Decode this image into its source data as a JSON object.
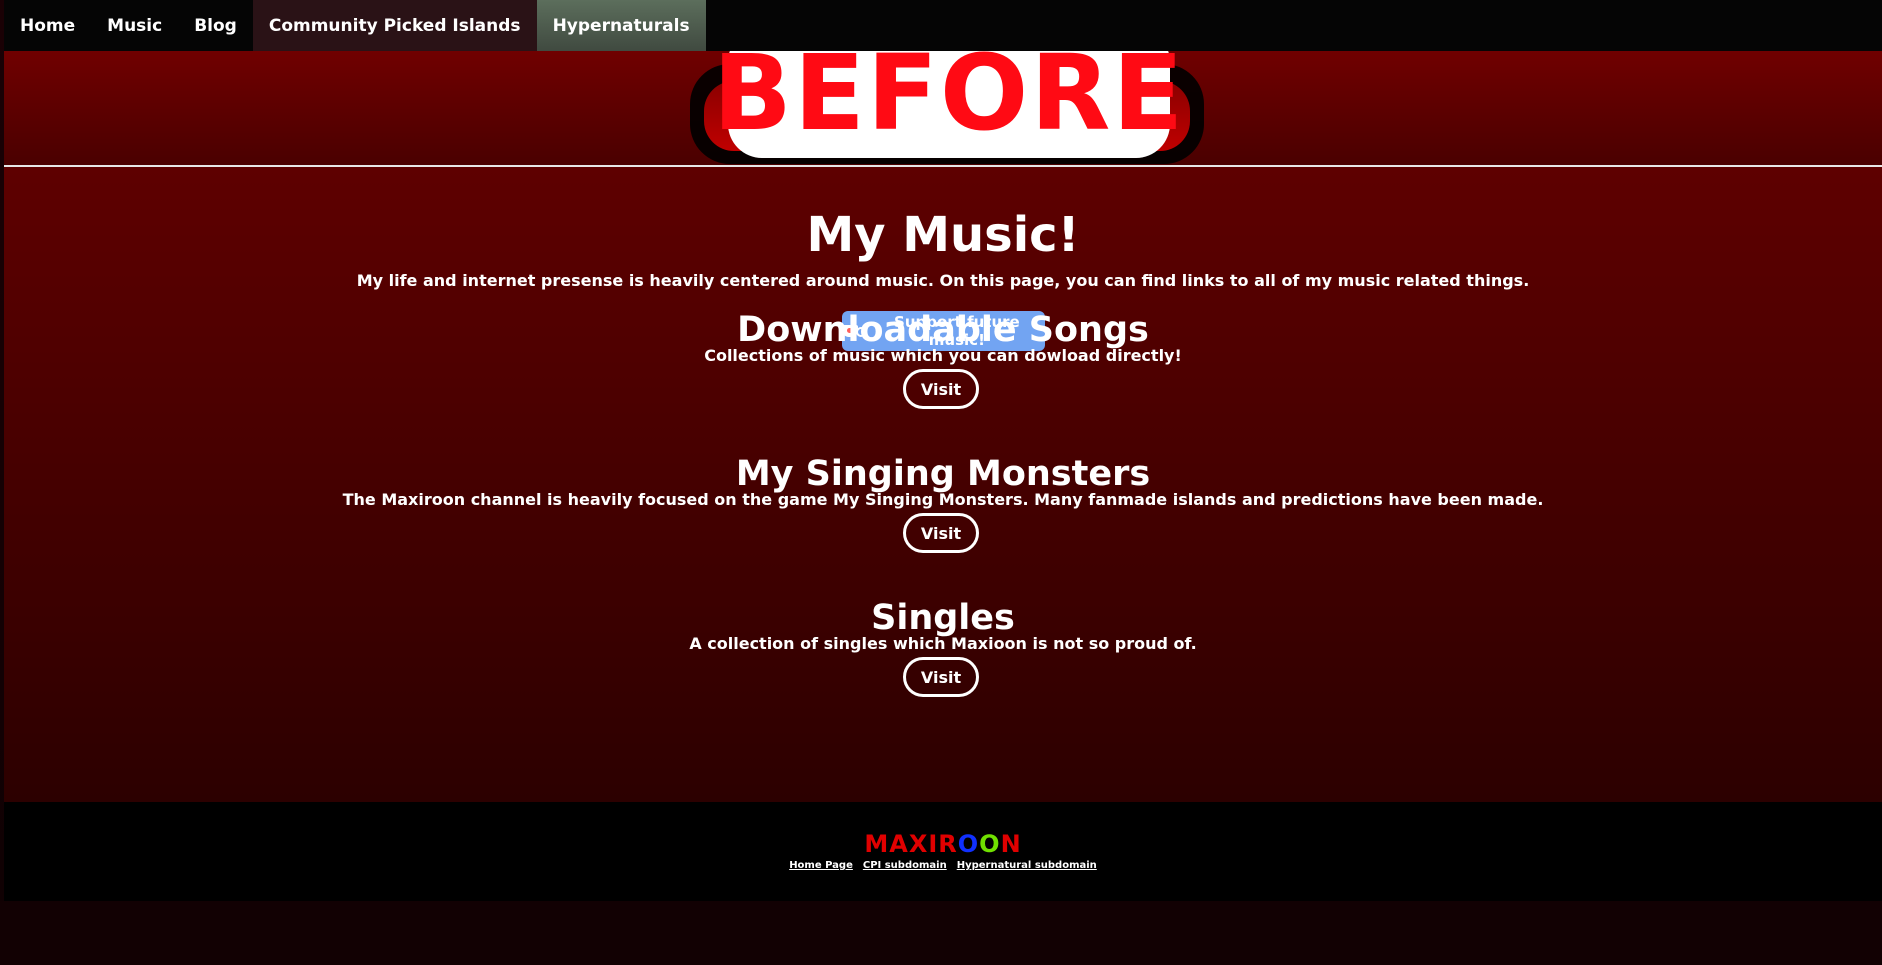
{
  "nav": {
    "items": [
      {
        "label": "Home"
      },
      {
        "label": "Music"
      },
      {
        "label": "Blog"
      },
      {
        "label": "Community Picked Islands"
      },
      {
        "label": "Hypernaturals"
      }
    ]
  },
  "banner": {
    "overlay_text": "BEFORE"
  },
  "main": {
    "title": "My Music!",
    "intro": "My life and internet presense is heavily centered around music. On this page, you can find links to all of my music related things.",
    "support_button": "Support future music!",
    "sections": [
      {
        "title": "Downloadable Songs",
        "description": "Collections of music which you can dowload directly!",
        "button": "Visit"
      },
      {
        "title": "My Singing Monsters",
        "description": "The Maxiroon channel is heavily focused on the game My Singing Monsters. Many fanmade islands and predictions have been made.",
        "button": "Visit"
      },
      {
        "title": "Singles",
        "description": "A collection of singles which Maxioon is not so proud of.",
        "button": "Visit"
      }
    ]
  },
  "footer": {
    "logo_letters": [
      {
        "char": "M",
        "color": "#e00000"
      },
      {
        "char": "A",
        "color": "#e00000"
      },
      {
        "char": "X",
        "color": "#e00000"
      },
      {
        "char": "I",
        "color": "#e00000"
      },
      {
        "char": "R",
        "color": "#e00000"
      },
      {
        "char": "O",
        "color": "#1030ff"
      },
      {
        "char": "O",
        "color": "#70e000"
      },
      {
        "char": "N",
        "color": "#e00000"
      }
    ],
    "links": [
      {
        "label": "Home Page"
      },
      {
        "label": "CPI subdomain"
      },
      {
        "label": "Hypernatural subdomain"
      }
    ]
  },
  "colors": {
    "support_button": "#72a4f2",
    "nav_cpi_bg": "#2a1216",
    "nav_hyper_bg": "#5c6e5c",
    "before_text": "#ff0a14"
  }
}
